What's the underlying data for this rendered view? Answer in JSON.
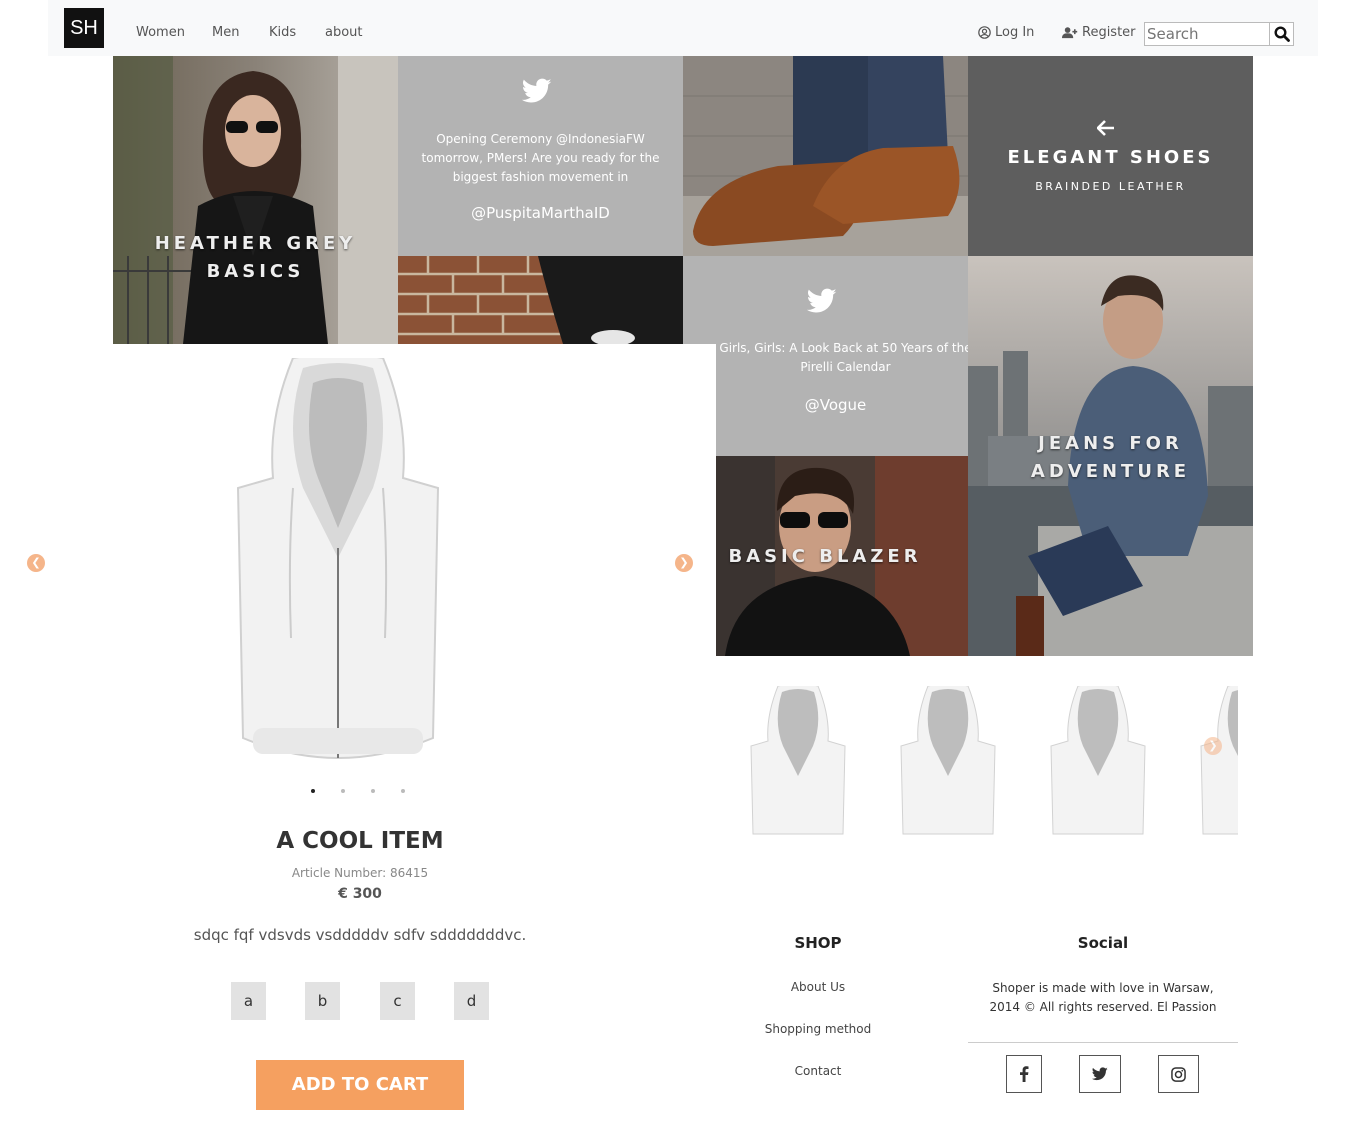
{
  "nav": {
    "brand": "SH",
    "links": [
      "Women",
      "Men",
      "Kids",
      "about"
    ],
    "login": "Log In",
    "register": "Register",
    "search_placeholder": "Search"
  },
  "tiles": {
    "heather_label": "HEATHER GREY BASICS",
    "tweet1": {
      "text": "Opening Ceremony @IndonesiaFW tomorrow, PMers! Are you ready for the biggest fashion movement in",
      "handle": "@PuspitaMarthaID"
    },
    "elegant_title": "ELEGANT SHOES",
    "elegant_subtitle": "BRAINDED LEATHER",
    "tweet2": {
      "text": "Girls, Girls: A Look Back at 50 Years of the Pirelli Calendar",
      "handle": "@Vogue"
    },
    "jeans_label": "JEANS FOR ADVENTURE",
    "blazer_label": "BASIC BLAZER"
  },
  "product": {
    "title": "A COOL ITEM",
    "article": "Article Number: 86415",
    "price": "€ 300",
    "description": "sdqc fqf vdsvds vsdddddv sdfv sdddddddvc.",
    "sizes": [
      "a",
      "b",
      "c",
      "d"
    ],
    "cart_label": "ADD TO CART",
    "carousel_slides": 4,
    "active_slide": 1
  },
  "footer": {
    "shop_heading": "SHOP",
    "shop_links": [
      "About Us",
      "Shopping method",
      "Contact"
    ],
    "social_heading": "Social",
    "social_text": "Shoper is made with love in Warsaw, 2014 © All rights reserved. El Passion",
    "social_icons": [
      "facebook-icon",
      "twitter-icon",
      "instagram-icon"
    ]
  },
  "colors": {
    "accent": "#f5a060",
    "tweet_bg": "#b3b3b3",
    "dark_tile": "#5e5e5e",
    "nav_bg": "#f8f9fa"
  }
}
